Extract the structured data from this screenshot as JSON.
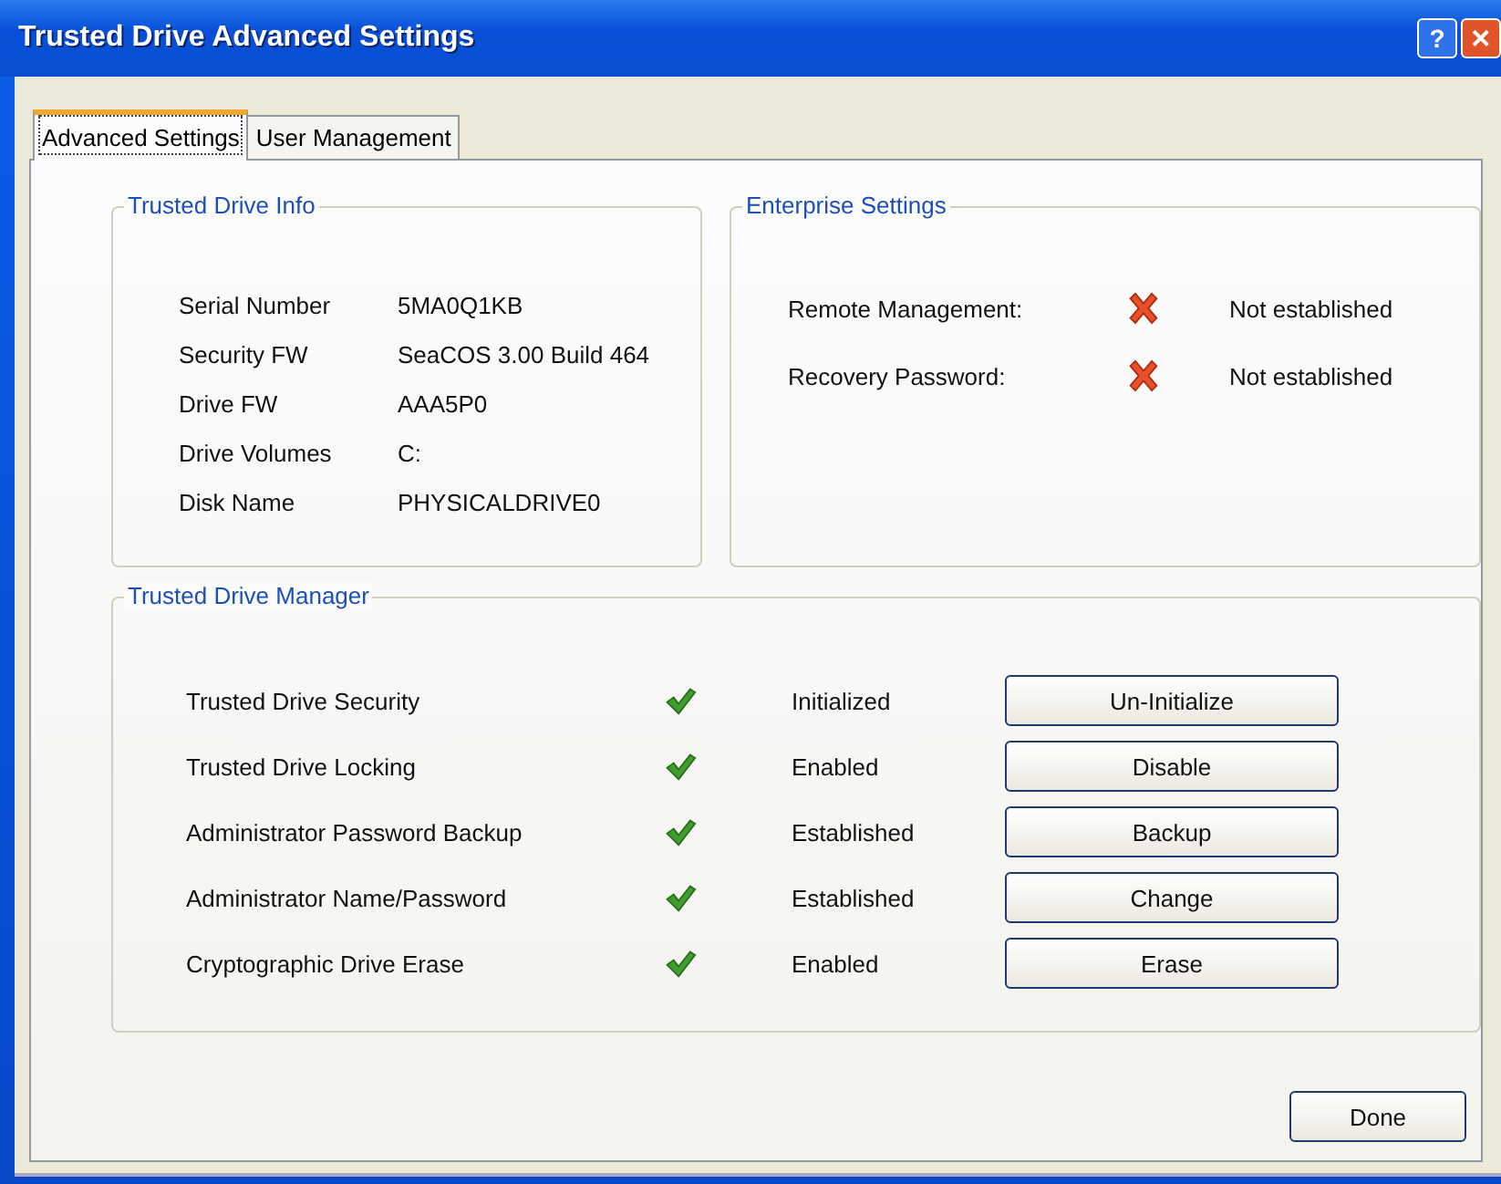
{
  "window": {
    "title": "Trusted Drive Advanced Settings",
    "title_buttons": [
      "?",
      "✕"
    ]
  },
  "tabs": [
    {
      "label": "Advanced Settings",
      "selected": true
    },
    {
      "label": "User Management",
      "selected": false
    }
  ],
  "drive_info": {
    "title": "Trusted Drive Info",
    "rows": [
      {
        "label": "Serial Number",
        "value": "5MA0Q1KB"
      },
      {
        "label": "Security FW",
        "value": "SeaCOS 3.00 Build 464"
      },
      {
        "label": "Drive FW",
        "value": "AAA5P0"
      },
      {
        "label": "Drive Volumes",
        "value": "C:"
      },
      {
        "label": "Disk Name",
        "value": "PHYSICALDRIVE0"
      }
    ]
  },
  "enterprise": {
    "title": "Enterprise Settings",
    "rows": [
      {
        "label": "Remote Management:",
        "ok": false,
        "status": "Not established"
      },
      {
        "label": "Recovery Password:",
        "ok": false,
        "status": "Not established"
      }
    ]
  },
  "manager": {
    "title": "Trusted Drive Manager",
    "rows": [
      {
        "label": "Trusted Drive Security",
        "ok": true,
        "status": "Initialized",
        "button": "Un-Initialize"
      },
      {
        "label": "Trusted Drive Locking",
        "ok": true,
        "status": "Enabled",
        "button": "Disable"
      },
      {
        "label": "Administrator Password Backup",
        "ok": true,
        "status": "Established",
        "button": "Backup"
      },
      {
        "label": "Administrator Name/Password",
        "ok": true,
        "status": "Established",
        "button": "Change"
      },
      {
        "label": "Cryptographic Drive Erase",
        "ok": true,
        "status": "Enabled",
        "button": "Erase"
      }
    ]
  },
  "buttons": [
    "Done"
  ]
}
